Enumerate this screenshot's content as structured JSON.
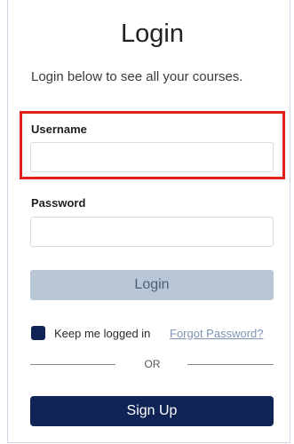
{
  "login": {
    "title": "Login",
    "subtitle": "Login below to see all your courses.",
    "username_label": "Username",
    "username_value": "",
    "password_label": "Password",
    "password_value": "",
    "login_button": "Login",
    "keep_logged_in_label": "Keep me logged in",
    "keep_logged_in_checked": true,
    "forgot_password_link": "Forgot Password?",
    "divider_text": "OR",
    "signup_button": "Sign Up"
  },
  "colors": {
    "highlight_border": "#e0201a",
    "primary_navy": "#0f2455",
    "disabled_button": "#b9c6d6",
    "link": "#7f95b6"
  }
}
